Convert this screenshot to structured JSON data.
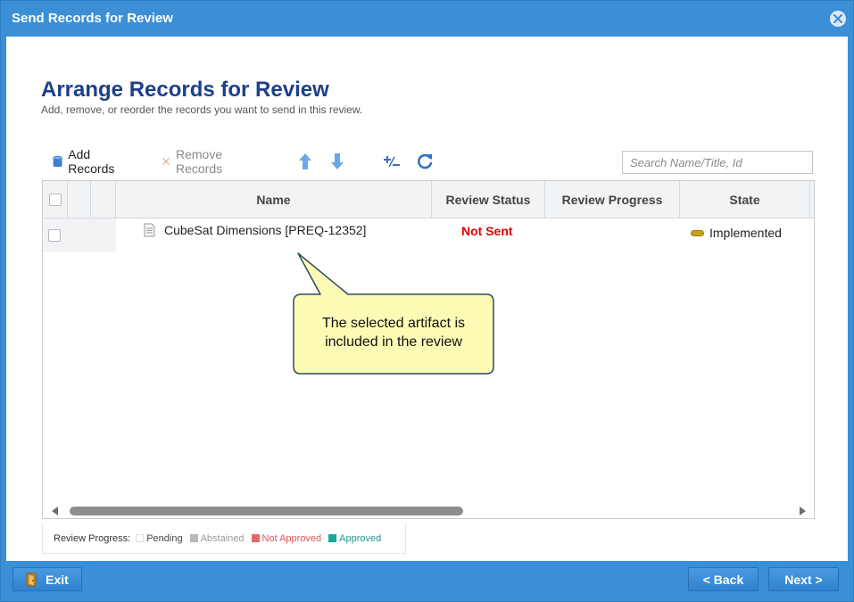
{
  "window": {
    "title": "Send Records for Review"
  },
  "page": {
    "heading": "Arrange Records for Review",
    "subheading": "Add, remove, or reorder the records you want to send in this review."
  },
  "toolbar": {
    "add_label": "Add Records",
    "remove_label": "Remove Records"
  },
  "search": {
    "placeholder": "Search Name/Title, Id",
    "value": ""
  },
  "grid": {
    "columns": {
      "name": "Name",
      "review_status": "Review Status",
      "review_progress": "Review Progress",
      "state": "State"
    },
    "rows": [
      {
        "name": "CubeSat Dimensions [PREQ-12352]",
        "review_status": "Not Sent",
        "review_progress": "",
        "state": "Implemented"
      }
    ]
  },
  "legend": {
    "label": "Review Progress:",
    "items": [
      "Pending",
      "Abstained",
      "Not Approved",
      "Approved"
    ]
  },
  "callout": {
    "line1": "The selected artifact is",
    "line2": "included in the review"
  },
  "footer": {
    "exit_label": "Exit",
    "back_label": "< Back",
    "next_label": "Next >"
  },
  "colors": {
    "accent": "#3a8fd6",
    "heading": "#1d3f8c",
    "status_not_sent": "#e00000",
    "approved": "#1aa89b",
    "not_approved": "#e46a6a",
    "abstained": "#b8b8b8",
    "callout_fill": "#fbfbb5",
    "callout_border": "#2d4a64"
  }
}
